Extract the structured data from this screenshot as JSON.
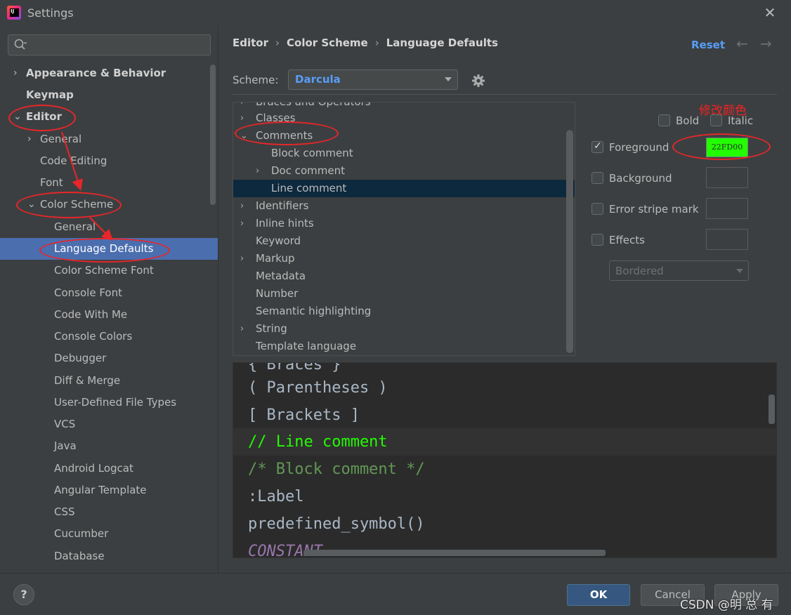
{
  "window": {
    "title": "Settings"
  },
  "sidebar": {
    "search_placeholder": "",
    "items": [
      {
        "label": "Appearance & Behavior"
      },
      {
        "label": "Keymap"
      },
      {
        "label": "Editor"
      },
      {
        "label": "General"
      },
      {
        "label": "Code Editing"
      },
      {
        "label": "Font"
      },
      {
        "label": "Color Scheme"
      },
      {
        "label": "General"
      },
      {
        "label": "Language Defaults"
      },
      {
        "label": "Color Scheme Font"
      },
      {
        "label": "Console Font"
      },
      {
        "label": "Code With Me"
      },
      {
        "label": "Console Colors"
      },
      {
        "label": "Debugger"
      },
      {
        "label": "Diff & Merge"
      },
      {
        "label": "User-Defined File Types"
      },
      {
        "label": "VCS"
      },
      {
        "label": "Java"
      },
      {
        "label": "Android Logcat"
      },
      {
        "label": "Angular Template"
      },
      {
        "label": "CSS"
      },
      {
        "label": "Cucumber"
      },
      {
        "label": "Database"
      }
    ]
  },
  "header": {
    "breadcrumb": [
      "Editor",
      "Color Scheme",
      "Language Defaults"
    ],
    "reset_label": "Reset",
    "scheme_label": "Scheme:",
    "scheme_value": "Darcula"
  },
  "tree": {
    "items": [
      {
        "label": "Braces and Operators"
      },
      {
        "label": "Classes"
      },
      {
        "label": "Comments"
      },
      {
        "label": "Block comment"
      },
      {
        "label": "Doc comment"
      },
      {
        "label": "Line comment"
      },
      {
        "label": "Identifiers"
      },
      {
        "label": "Inline hints"
      },
      {
        "label": "Keyword"
      },
      {
        "label": "Markup"
      },
      {
        "label": "Metadata"
      },
      {
        "label": "Number"
      },
      {
        "label": "Semantic highlighting"
      },
      {
        "label": "String"
      },
      {
        "label": "Template language"
      }
    ]
  },
  "attributes": {
    "bold_label": "Bold",
    "italic_label": "Italic",
    "foreground_label": "Foreground",
    "foreground_value": "22FD00",
    "foreground_color": "#22fd00",
    "background_label": "Background",
    "error_stripe_label": "Error stripe mark",
    "effects_label": "Effects",
    "effects_value": "Bordered",
    "annotation": "修改颜色"
  },
  "preview": {
    "lines": [
      "{ Braces }",
      "( Parentheses )",
      "[ Brackets ]",
      "// Line comment",
      "/* Block comment */",
      ":Label",
      "predefined_symbol()",
      "CONSTANT"
    ],
    "colors": {
      "default": "#a9b7c6",
      "line_comment": "#22fd00",
      "block_comment": "#629755",
      "constant": "#9876aa"
    }
  },
  "footer": {
    "help_label": "?",
    "ok_label": "OK",
    "cancel_label": "Cancel",
    "apply_label": "Apply",
    "watermark": "CSDN @明 总 有"
  }
}
